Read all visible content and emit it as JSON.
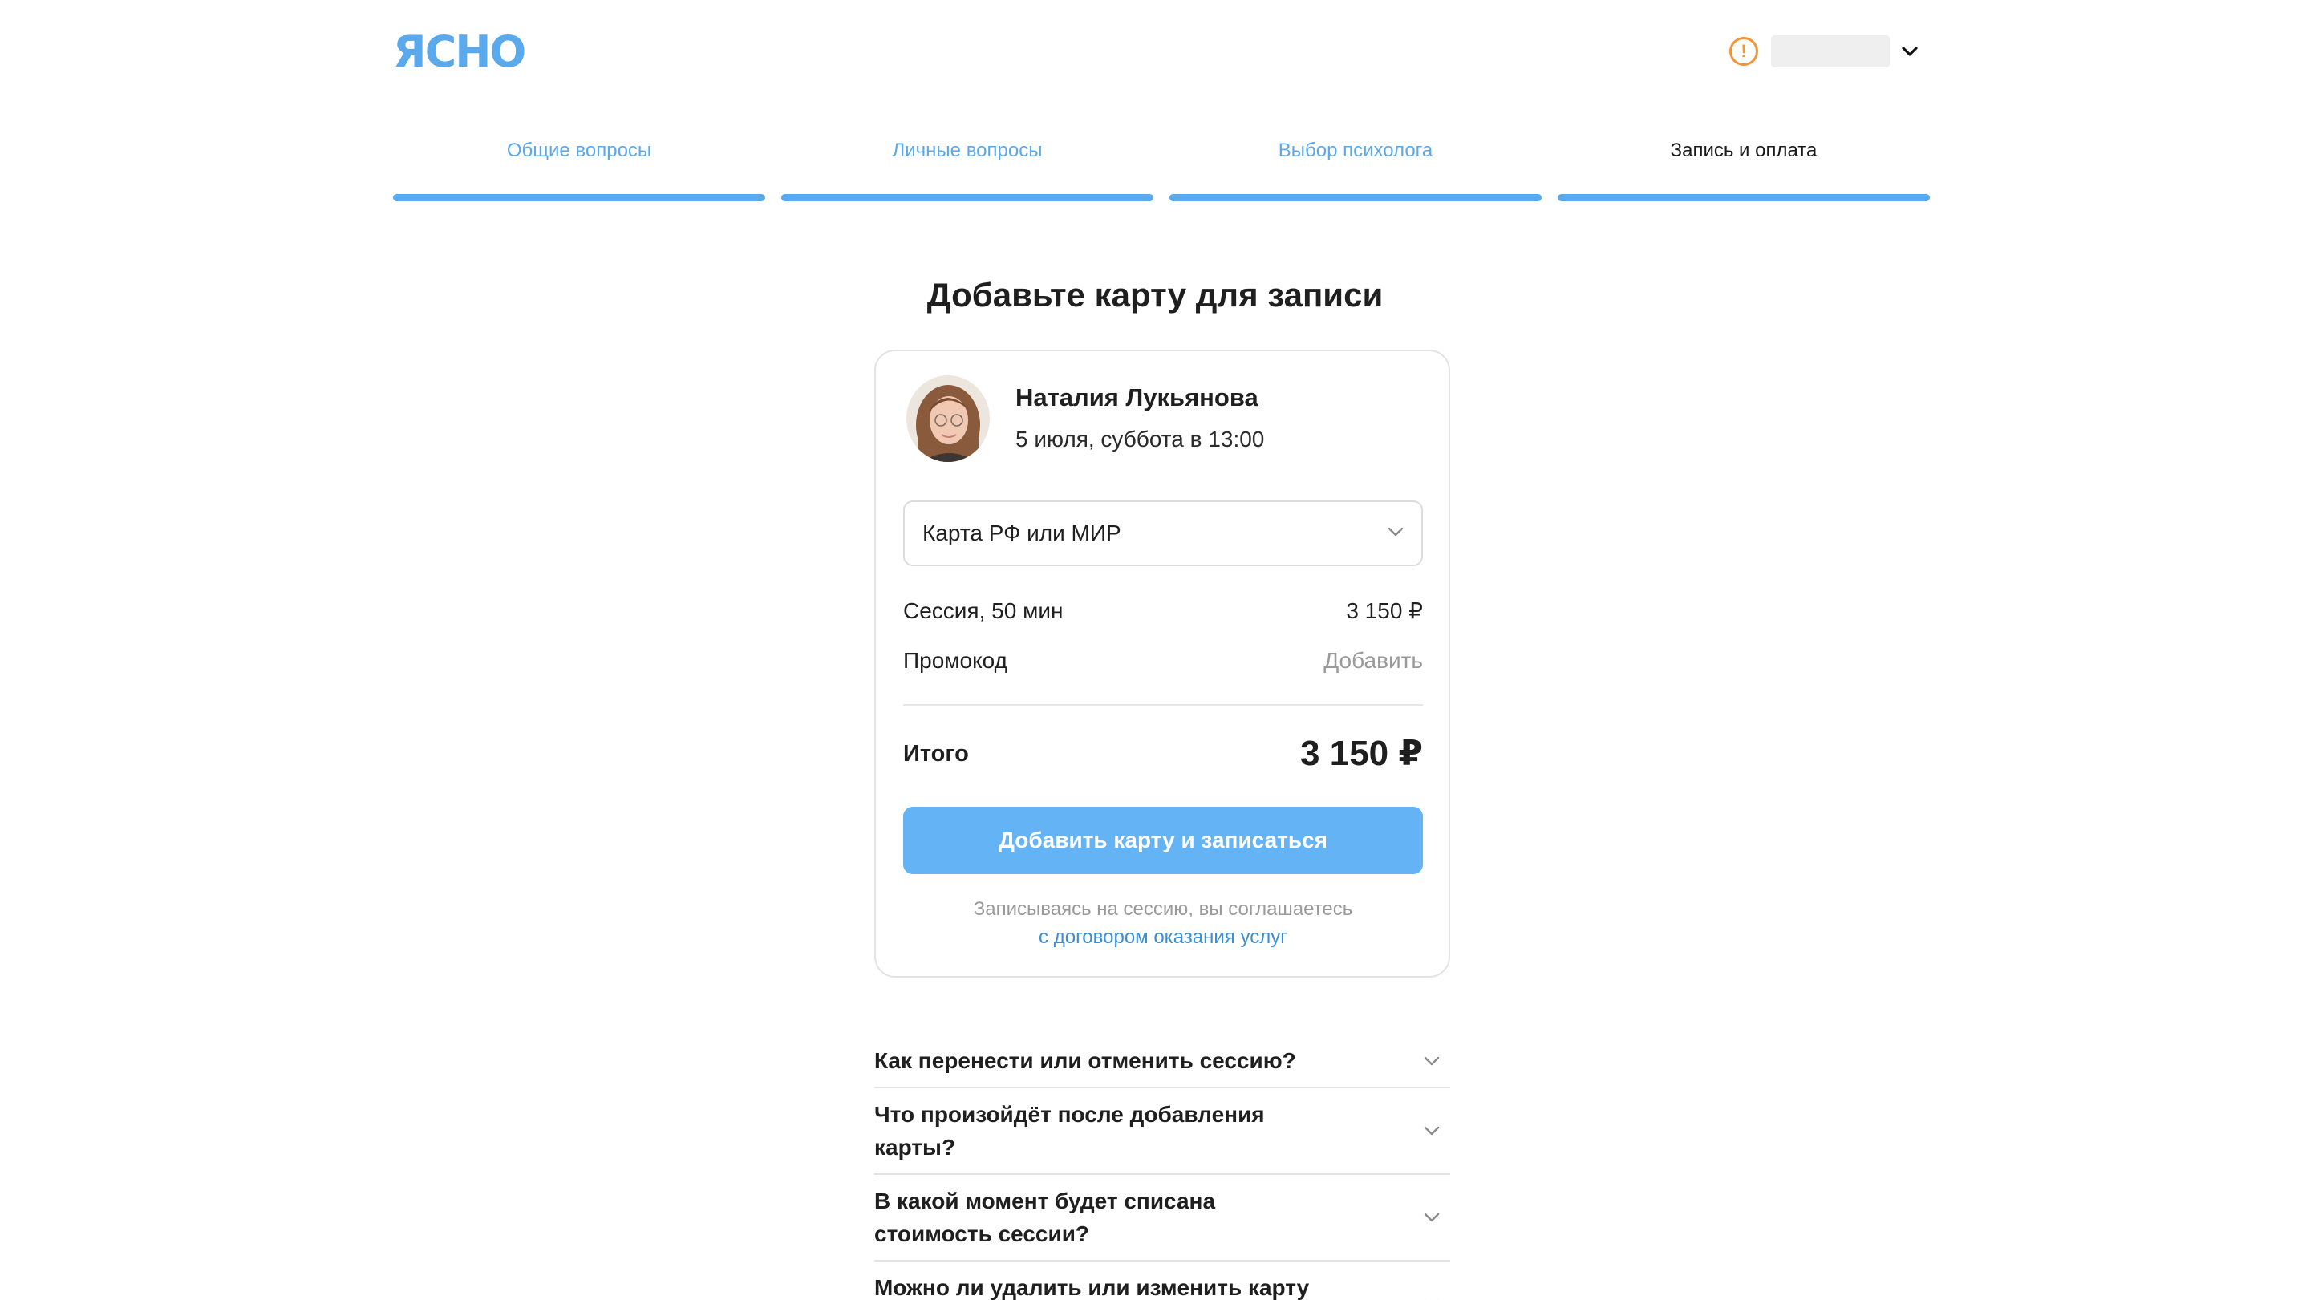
{
  "header": {
    "logo": "ЯСНО",
    "account_alert_icon": "warning-circle-icon",
    "account_menu_icon": "chevron-down-icon"
  },
  "steps": [
    {
      "label": "Общие вопросы",
      "active": false
    },
    {
      "label": "Личные вопросы",
      "active": false
    },
    {
      "label": "Выбор психолога",
      "active": false
    },
    {
      "label": "Запись и оплата",
      "active": true
    }
  ],
  "page_title": "Добавьте карту для записи",
  "booking": {
    "psychologist_name": "Наталия Лукьянова",
    "session_datetime": "5 июля, суббота в 13:00",
    "payment_method": {
      "selected": "Карта РФ или МИР"
    },
    "session": {
      "label": "Сессия, 50 мин",
      "price": "3 150 ₽"
    },
    "promo": {
      "label": "Промокод",
      "action": "Добавить"
    },
    "total": {
      "label": "Итого",
      "value": "3 150 ₽"
    },
    "submit_label": "Добавить карту и записаться",
    "terms_text": "Записываясь на сессию, вы соглашаетесь",
    "terms_link": "с договором оказания услуг"
  },
  "faq": [
    "Как перенести или отменить сессию?",
    "Что произойдёт после добавления карты?",
    "В какой момент будет списана стоимость сессии?",
    "Можно ли удалить или изменить карту после добавления?"
  ],
  "colors": {
    "accent": "#5aa9ec",
    "button": "#64b3f4",
    "warning": "#f0963a",
    "link": "#3a8ed6"
  }
}
